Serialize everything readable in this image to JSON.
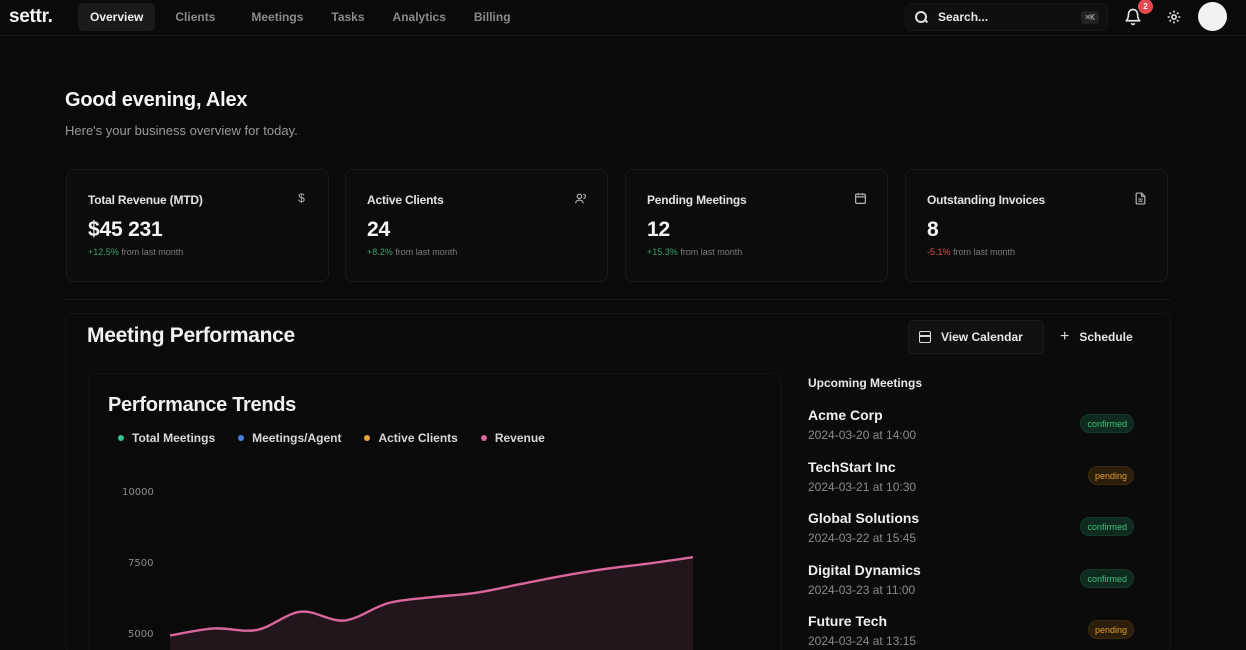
{
  "app": {
    "logo": "settr."
  },
  "nav": {
    "items": [
      "Overview",
      "Clients",
      "Meetings",
      "Tasks",
      "Analytics",
      "Billing"
    ],
    "active": "Overview"
  },
  "search": {
    "placeholder": "Search...",
    "shortcut": "⌘K"
  },
  "notifications": {
    "count": "2"
  },
  "greeting": {
    "title": "Good evening, Alex",
    "subtitle": "Here's your business overview for today."
  },
  "stats": [
    {
      "title": "Total Revenue (MTD)",
      "value": "$45 231",
      "delta": "+12.5%",
      "delta_text": "from last month",
      "icon": "dollar-icon",
      "trend": "pos"
    },
    {
      "title": "Active Clients",
      "value": "24",
      "delta": "+8.2%",
      "delta_text": "from last month",
      "icon": "users-icon",
      "trend": "pos"
    },
    {
      "title": "Pending Meetings",
      "value": "12",
      "delta": "+15.3%",
      "delta_text": "from last month",
      "icon": "calendar-icon",
      "trend": "pos"
    },
    {
      "title": "Outstanding Invoices",
      "value": "8",
      "delta": "-5.1%",
      "delta_text": "from last month",
      "icon": "file-icon",
      "trend": "neg"
    }
  ],
  "performance": {
    "title": "Meeting Performance",
    "buttons": {
      "calendar": "View Calendar",
      "schedule": "Schedule"
    }
  },
  "trends": {
    "title": "Performance Trends",
    "legend": [
      {
        "label": "Total Meetings",
        "color": "#34c38f"
      },
      {
        "label": "Meetings/Agent",
        "color": "#4f7fe0"
      },
      {
        "label": "Active Clients",
        "color": "#e8a23a"
      },
      {
        "label": "Revenue",
        "color": "#d8679a"
      }
    ],
    "yticks": [
      "10000",
      "7500",
      "5000"
    ]
  },
  "chart_data": {
    "type": "area",
    "series": [
      {
        "name": "Revenue",
        "values": [
          4980,
          5230,
          5180,
          5820,
          5510,
          6120,
          6330,
          6480,
          6780,
          7080,
          7330,
          7520,
          7740
        ]
      }
    ],
    "ylim": [
      4500,
      10000
    ]
  },
  "upcoming": {
    "title": "Upcoming Meetings",
    "items": [
      {
        "name": "Acme Corp",
        "time": "2024-03-20 at 14:00",
        "status": "confirmed"
      },
      {
        "name": "TechStart Inc",
        "time": "2024-03-21 at 10:30",
        "status": "pending"
      },
      {
        "name": "Global Solutions",
        "time": "2024-03-22 at 15:45",
        "status": "confirmed"
      },
      {
        "name": "Digital Dynamics",
        "time": "2024-03-23 at 11:00",
        "status": "confirmed"
      },
      {
        "name": "Future Tech",
        "time": "2024-03-24 at 13:15",
        "status": "pending"
      }
    ]
  }
}
